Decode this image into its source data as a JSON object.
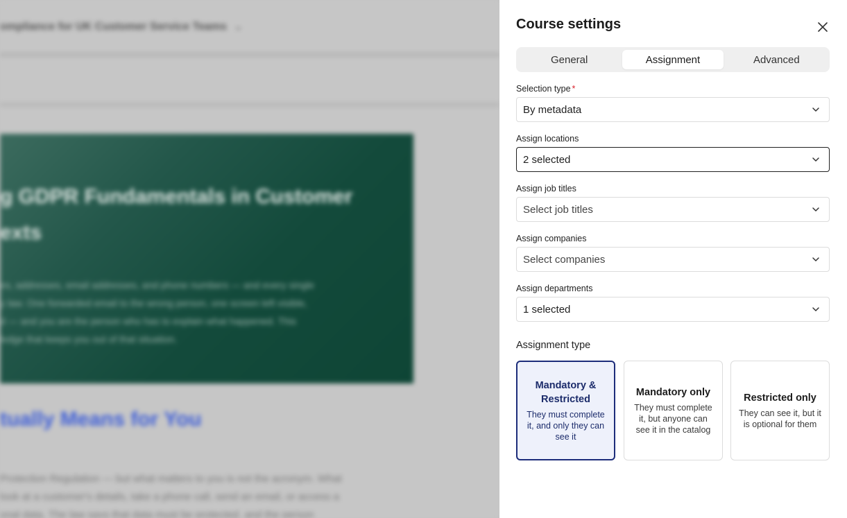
{
  "background": {
    "breadcrumb": "ompliance for UK Customer Service Teams",
    "hero_title_lines": [
      "g GDPR Fundamentals in Customer",
      "exts"
    ],
    "hero_body_lines": [
      "es, addresses, email addresses, and phone numbers — and every single",
      "y law. One forwarded email to the wrong person, one screen left visible,",
      "d — and you are the person who has to explain what happened. This",
      "ledge that keeps you out of that situation."
    ],
    "section_heading": "tually Means for You",
    "paragraph_lines": [
      "Protection Regulation — but what matters to you is not the acronym. What",
      "look at a customer's details, take a phone call, send an email, or access a",
      "onal data. The law says that data must be protected, and the person"
    ]
  },
  "panel": {
    "title": "Course settings",
    "tabs": [
      {
        "label": "General",
        "active": false
      },
      {
        "label": "Assignment",
        "active": true
      },
      {
        "label": "Advanced",
        "active": false
      }
    ],
    "fields": {
      "selection_type": {
        "label": "Selection type",
        "required_mark": "*",
        "value": "By metadata"
      },
      "locations": {
        "label": "Assign locations",
        "value": "2 selected"
      },
      "job_titles": {
        "label": "Assign job titles",
        "placeholder": "Select job titles"
      },
      "companies": {
        "label": "Assign companies",
        "placeholder": "Select companies"
      },
      "departments": {
        "label": "Assign departments",
        "value": "1 selected"
      }
    },
    "assignment_type": {
      "title": "Assignment type",
      "options": [
        {
          "title": "Mandatory & Restricted",
          "description": "They must complete it, and only they can see it",
          "selected": true
        },
        {
          "title": "Mandatory only",
          "description": "They must complete it, but anyone can see it in the catalog",
          "selected": false
        },
        {
          "title": "Restricted only",
          "description": "They can see it, but it is optional for them",
          "selected": false
        }
      ]
    }
  },
  "colors": {
    "selected_border": "#1c2c7a",
    "selected_fill": "#eef1fb",
    "required": "#d9232d",
    "hero_green": "#134a3b",
    "heading_blue": "#4060d8"
  }
}
